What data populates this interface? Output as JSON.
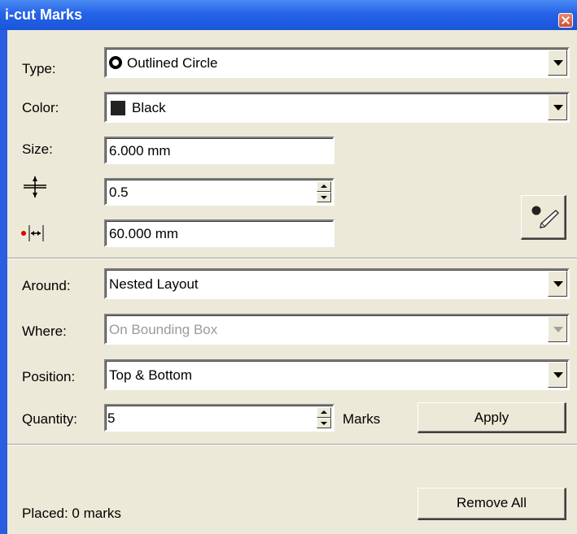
{
  "window": {
    "title": "i-cut Marks"
  },
  "type": {
    "label": "Type:",
    "value": "Outlined Circle"
  },
  "color": {
    "label": "Color:",
    "value": "Black",
    "swatch": "#222222"
  },
  "size": {
    "label": "Size:",
    "value": "6.000 mm"
  },
  "thickness": {
    "value": "0.5"
  },
  "spacing": {
    "value": "60.000 mm"
  },
  "around": {
    "label": "Around:",
    "value": "Nested Layout"
  },
  "where": {
    "label": "Where:",
    "value": "On Bounding Box"
  },
  "position": {
    "label": "Position:",
    "value": "Top & Bottom"
  },
  "quantity": {
    "label": "Quantity:",
    "value": "5",
    "unit": "Marks"
  },
  "buttons": {
    "apply": "Apply",
    "remove_all": "Remove All"
  },
  "status": {
    "placed": "Placed: 0 marks"
  },
  "icons": {
    "pen": "pen-mark-icon",
    "thickness": "crosshair-thickness-icon",
    "spacing": "mark-spacing-icon"
  }
}
